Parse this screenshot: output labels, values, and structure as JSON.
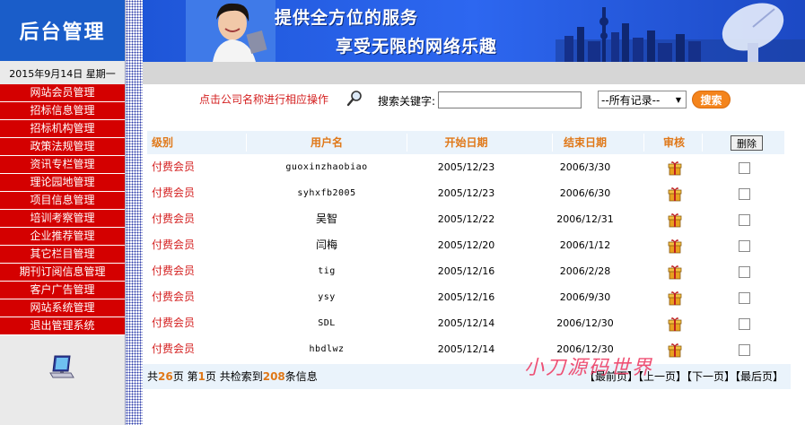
{
  "sidebar": {
    "title": "后台管理",
    "date": "2015年9月14日 星期一",
    "items": [
      {
        "label": "网站会员管理"
      },
      {
        "label": "招标信息管理"
      },
      {
        "label": "招标机构管理"
      },
      {
        "label": "政策法规管理"
      },
      {
        "label": "资讯专栏管理"
      },
      {
        "label": "理论园地管理"
      },
      {
        "label": "项目信息管理"
      },
      {
        "label": "培训考察管理"
      },
      {
        "label": "企业推荐管理"
      },
      {
        "label": "其它栏目管理"
      },
      {
        "label": "期刊订阅信息管理"
      },
      {
        "label": "客户广告管理"
      },
      {
        "label": "网站系统管理"
      },
      {
        "label": "退出管理系统"
      }
    ]
  },
  "banner": {
    "line1": "提供全方位的服务",
    "line2": "享受无限的网络乐趣"
  },
  "search": {
    "hint": "点击公司名称进行相应操作",
    "label": "搜索关键字:",
    "value": "",
    "select_value": "--所有记录--",
    "button": "搜索"
  },
  "table": {
    "headers": {
      "level": "级别",
      "user": "用户名",
      "start": "开始日期",
      "end": "结束日期",
      "audit": "审核",
      "delete": "删除"
    },
    "rows": [
      {
        "level": "付费会员",
        "user": "guoxinzhaobiao",
        "start": "2005/12/23",
        "end": "2006/3/30"
      },
      {
        "level": "付费会员",
        "user": "syhxfb2005",
        "start": "2005/12/23",
        "end": "2006/6/30"
      },
      {
        "level": "付费会员",
        "user": "吴智",
        "start": "2005/12/22",
        "end": "2006/12/31"
      },
      {
        "level": "付费会员",
        "user": "闫梅",
        "start": "2005/12/20",
        "end": "2006/1/12"
      },
      {
        "level": "付费会员",
        "user": "tig",
        "start": "2005/12/16",
        "end": "2006/2/28"
      },
      {
        "level": "付费会员",
        "user": "ysy",
        "start": "2005/12/16",
        "end": "2006/9/30"
      },
      {
        "level": "付费会员",
        "user": "SDL",
        "start": "2005/12/14",
        "end": "2006/12/30"
      },
      {
        "level": "付费会员",
        "user": "hbdlwz",
        "start": "2005/12/14",
        "end": "2006/12/30"
      }
    ]
  },
  "pager": {
    "prefix": "共",
    "pages": "26",
    "pages_suffix": "页 第",
    "current": "1",
    "current_suffix": "页 共检索到",
    "total": "208",
    "total_suffix": "条信息",
    "links": "【最前页】【上一页】【下一页】【最后页】"
  },
  "watermark": "小刀源码世界",
  "colors": {
    "sidebar_title_bg": "#1a5dc9",
    "menu_bg": "#d40000",
    "header_text": "#e07818",
    "level_text": "#d42020",
    "search_button": "#f4841c"
  }
}
